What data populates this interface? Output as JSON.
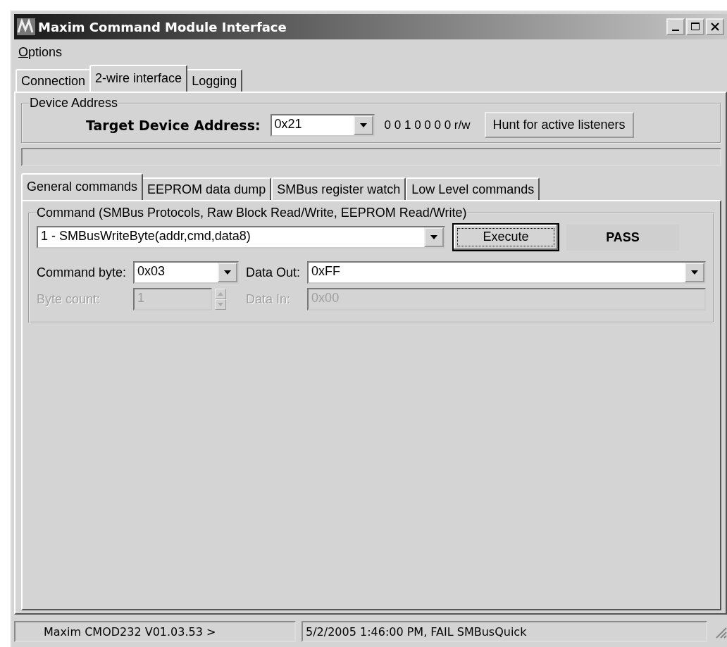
{
  "window": {
    "title": "Maxim Command Module Interface"
  },
  "menu": [
    {
      "label": "Options",
      "mnemonic_underlined": true
    }
  ],
  "tabs": [
    {
      "label": "Connection",
      "selected": false
    },
    {
      "label": "2-wire interface",
      "selected": true
    },
    {
      "label": "Logging",
      "selected": false
    }
  ],
  "device_address": {
    "group_title": "Device Address",
    "label": "Target Device Address:",
    "value": "0x21",
    "bits": "0 0 1 0 0 0 0 r/w",
    "button": "Hunt for active listeners"
  },
  "subtabs": [
    {
      "label": "General commands",
      "selected": true
    },
    {
      "label": "EEPROM data dump",
      "selected": false
    },
    {
      "label": "SMBus register watch",
      "selected": false
    },
    {
      "label": "Low Level commands",
      "selected": false
    }
  ],
  "command": {
    "group_title": "Command (SMBus Protocols, Raw Block Read/Write, EEPROM Read/Write)",
    "value": "1 - SMBusWriteByte(addr,cmd,data8)",
    "button": "Execute",
    "button_focused": true,
    "result": "PASS"
  },
  "fields": [
    {
      "label": "Command byte:",
      "value": "0x03",
      "kind": "combo",
      "disabled": false
    },
    {
      "label": "Data Out:",
      "value": "0xFF",
      "kind": "combo",
      "disabled": false
    },
    {
      "label": "Byte count:",
      "value": "1",
      "kind": "spin",
      "disabled": true
    },
    {
      "label": "Data In:",
      "value": "0x00",
      "kind": "text",
      "disabled": true
    }
  ],
  "status_bar": [
    "Maxim CMOD232 V01.03.53 >",
    "5/2/2005 1:46:00 PM, FAIL SMBusQuick"
  ]
}
